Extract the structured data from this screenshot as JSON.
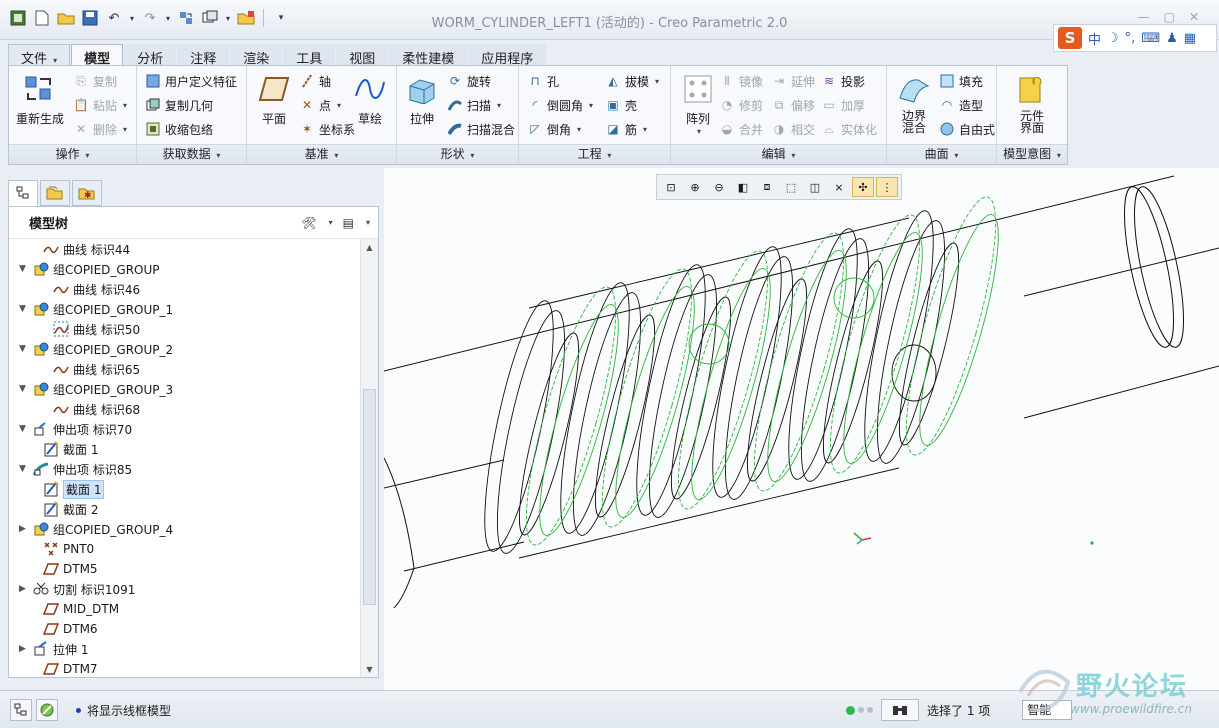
{
  "window": {
    "title": "WORM_CYLINDER_LEFT1 (活动的) - Creo Parametric 2.0"
  },
  "ime": {
    "mode": "中"
  },
  "tabs": [
    {
      "label": "文件",
      "caret": "▾"
    },
    {
      "label": "模型"
    },
    {
      "label": "分析"
    },
    {
      "label": "注释"
    },
    {
      "label": "渲染"
    },
    {
      "label": "工具"
    },
    {
      "label": "视图"
    },
    {
      "label": "柔性建模"
    },
    {
      "label": "应用程序"
    }
  ],
  "ribbon": {
    "operations": {
      "label": "操作",
      "regenerate": "重新生成",
      "copy": "复制",
      "paste": "粘贴",
      "delete": "删除"
    },
    "get_data": {
      "label": "获取数据",
      "udf": "用户定义特征",
      "copy_geom": "复制几何",
      "shrinkwrap": "收缩包络"
    },
    "datum": {
      "label": "基准",
      "plane": "平面",
      "axis": "轴",
      "point": "点",
      "csys": "坐标系",
      "sketch": "草绘"
    },
    "shapes": {
      "label": "形状",
      "extrude": "拉伸",
      "revolve": "旋转",
      "sweep": "扫描",
      "swept_blend": "扫描混合"
    },
    "engineering": {
      "label": "工程",
      "hole": "孔",
      "round": "倒圆角",
      "chamfer": "倒角",
      "draft": "拔模",
      "shell": "壳",
      "rib": "筋"
    },
    "editing": {
      "label": "编辑",
      "pattern": "阵列",
      "mirror": "镜像",
      "trim": "修剪",
      "merge": "合并",
      "extend": "延伸",
      "offset": "偏移",
      "intersect": "相交",
      "project": "投影",
      "thicken": "加厚",
      "solidify": "实体化"
    },
    "surfaces": {
      "label": "曲面",
      "boundary_blend": "边界混合",
      "fill": "填充",
      "style": "造型",
      "freestyle": "自由式"
    },
    "model_intent": {
      "label": "模型意图",
      "component_interface": "元件界面"
    }
  },
  "model_tree": {
    "title": "模型树",
    "items": [
      {
        "label": "曲线 标识44",
        "indent": 1,
        "icon": "curve-icon",
        "expander": ""
      },
      {
        "label": "组COPIED_GROUP",
        "indent": 0,
        "icon": "group-icon",
        "expander": "▼"
      },
      {
        "label": "曲线 标识46",
        "indent": 2,
        "icon": "curve-icon",
        "expander": ""
      },
      {
        "label": "组COPIED_GROUP_1",
        "indent": 0,
        "icon": "group-icon",
        "expander": "▼"
      },
      {
        "label": "曲线 标识50",
        "indent": 2,
        "icon": "curve-dotted-icon",
        "expander": ""
      },
      {
        "label": "组COPIED_GROUP_2",
        "indent": 0,
        "icon": "group-icon",
        "expander": "▼"
      },
      {
        "label": "曲线 标识65",
        "indent": 2,
        "icon": "curve-icon",
        "expander": ""
      },
      {
        "label": "组COPIED_GROUP_3",
        "indent": 0,
        "icon": "group-icon",
        "expander": "▼"
      },
      {
        "label": "曲线 标识68",
        "indent": 2,
        "icon": "curve-icon",
        "expander": ""
      },
      {
        "label": "伸出项 标识70",
        "indent": 0,
        "icon": "protrusion-icon",
        "expander": "▼"
      },
      {
        "label": "截面 1",
        "indent": 1,
        "icon": "section-icon",
        "expander": ""
      },
      {
        "label": "伸出项 标识85",
        "indent": 0,
        "icon": "protrusion-sweep-icon",
        "expander": "▼"
      },
      {
        "label": "截面 1",
        "indent": 1,
        "icon": "section-icon",
        "expander": "",
        "selected": true
      },
      {
        "label": "截面 2",
        "indent": 1,
        "icon": "section-icon",
        "expander": ""
      },
      {
        "label": "组COPIED_GROUP_4",
        "indent": 0,
        "icon": "group-icon",
        "expander": "▶"
      },
      {
        "label": "PNT0",
        "indent": 1,
        "icon": "datum-point-icon",
        "expander": ""
      },
      {
        "label": "DTM5",
        "indent": 1,
        "icon": "datum-plane-icon",
        "expander": ""
      },
      {
        "label": "切割 标识1091",
        "indent": 0,
        "icon": "cut-icon",
        "expander": "▶"
      },
      {
        "label": "MID_DTM",
        "indent": 1,
        "icon": "datum-plane-icon",
        "expander": ""
      },
      {
        "label": "DTM6",
        "indent": 1,
        "icon": "datum-plane-icon",
        "expander": ""
      },
      {
        "label": "拉伸 1",
        "indent": 0,
        "icon": "extrude-icon",
        "expander": "▶"
      },
      {
        "label": "DTM7",
        "indent": 1,
        "icon": "datum-plane-icon",
        "expander": ""
      }
    ]
  },
  "status": {
    "message": "将显示线框模型",
    "selection": "选择了 1 项",
    "filter": "智能"
  },
  "watermark": {
    "text": "野火论坛",
    "url": "www.proewildfire.cn"
  },
  "colors": {
    "accent": "#2f6fc4",
    "green_curve": "#2bb53a",
    "wire": "#111111"
  }
}
